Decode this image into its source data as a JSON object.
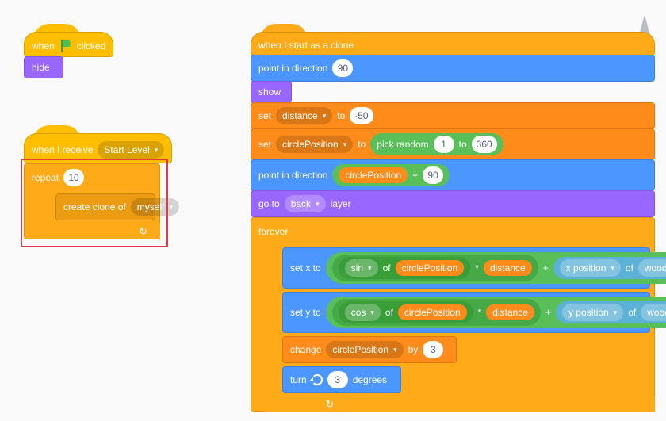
{
  "colors": {
    "events": "#ffbf00",
    "looks": "#9966ff",
    "control": "#ffab19",
    "motion": "#4c97ff",
    "data": "#ff8c1a",
    "operators": "#59c059",
    "sensing": "#5cb1d6"
  },
  "stack1": {
    "when_flag_clicked": "when",
    "when_flag_clicked_suffix": "clicked",
    "hide": "hide"
  },
  "stack2": {
    "when_receive": "when I receive",
    "message": "Start Level",
    "repeat": "repeat",
    "repeat_count": "10",
    "create_clone": "create clone of",
    "clone_target": "myself"
  },
  "stack3": {
    "start_clone": "when I start as a clone",
    "point_dir": "point in direction",
    "dir_val": "90",
    "show": "show",
    "set": "set",
    "to": "to",
    "distance_var": "distance",
    "distance_val": "-50",
    "circle_var": "circlePosition",
    "pick_random": "pick random",
    "rand_lo": "1",
    "rand_hi": "360",
    "plus": "+",
    "plus_val": "90",
    "goto": "go to",
    "back": "back",
    "layer": "layer",
    "forever": "forever",
    "setx": "set x to",
    "sety": "set y to",
    "sin": "sin",
    "cos": "cos",
    "of": "of",
    "times": "*",
    "xpos": "x position",
    "ypos": "y position",
    "wood": "wood",
    "change": "change",
    "by": "by",
    "change_val": "3",
    "turn": "turn",
    "turn_val": "3",
    "degrees": "degrees"
  }
}
